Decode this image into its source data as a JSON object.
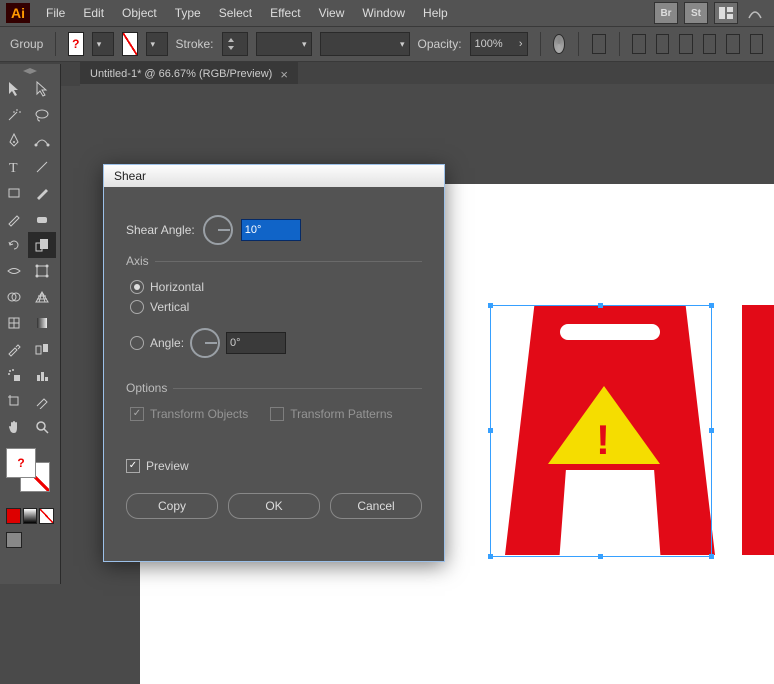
{
  "app": {
    "logo": "Ai"
  },
  "menu": {
    "items": [
      "File",
      "Edit",
      "Object",
      "Type",
      "Select",
      "Effect",
      "View",
      "Window",
      "Help"
    ],
    "right_badges": [
      "Br",
      "St"
    ]
  },
  "options_bar": {
    "context_label": "Group",
    "stroke_label": "Stroke:",
    "opacity_label": "Opacity:",
    "opacity_value": "100%"
  },
  "document": {
    "tab_title": "Untitled-1* @ 66.67% (RGB/Preview)"
  },
  "tool_names": [
    [
      "selection",
      "direct-selection"
    ],
    [
      "magic-wand",
      "lasso"
    ],
    [
      "pen",
      "curvature"
    ],
    [
      "type",
      "line"
    ],
    [
      "rectangle",
      "paintbrush"
    ],
    [
      "pencil",
      "eraser"
    ],
    [
      "rotate",
      "scale"
    ],
    [
      "width",
      "free-transform"
    ],
    [
      "shape-builder",
      "perspective"
    ],
    [
      "mesh",
      "gradient"
    ],
    [
      "eyedropper",
      "blend"
    ],
    [
      "symbol-sprayer",
      "column-graph"
    ],
    [
      "artboard",
      "slice"
    ],
    [
      "hand",
      "zoom"
    ]
  ],
  "dialog": {
    "title": "Shear",
    "shear_angle_label": "Shear Angle:",
    "shear_angle_value": "10°",
    "axis": {
      "title": "Axis",
      "horizontal": "Horizontal",
      "vertical": "Vertical",
      "angle_label": "Angle:",
      "angle_value": "0°"
    },
    "options": {
      "title": "Options",
      "transform_objects": "Transform Objects",
      "transform_patterns": "Transform Patterns"
    },
    "preview_label": "Preview",
    "buttons": {
      "copy": "Copy",
      "ok": "OK",
      "cancel": "Cancel"
    }
  }
}
